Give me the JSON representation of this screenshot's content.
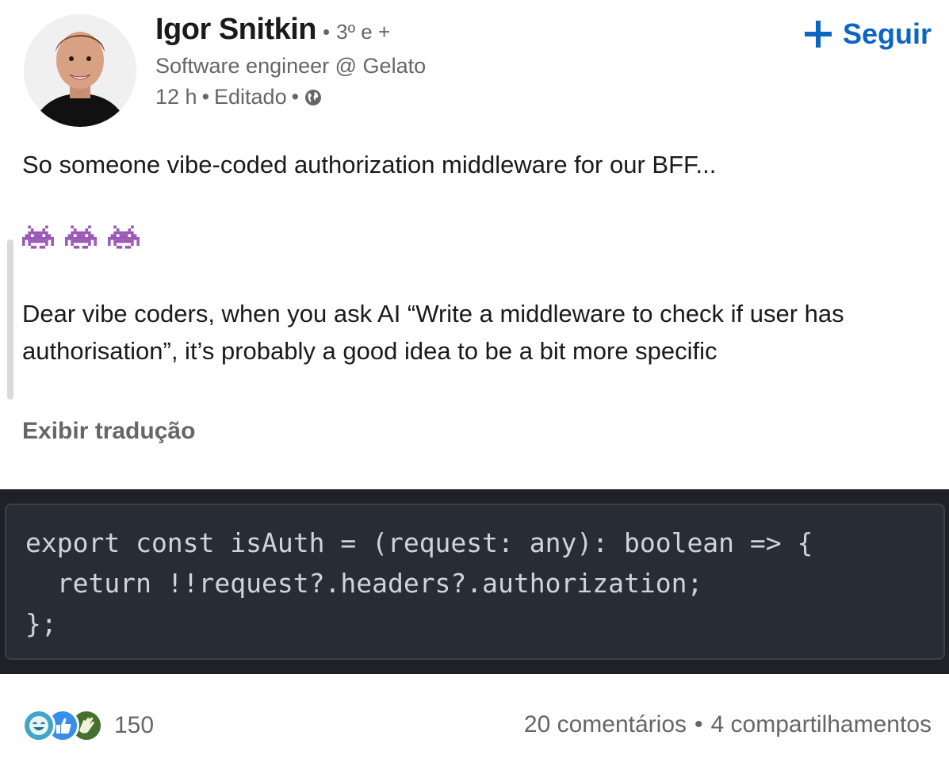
{
  "author": {
    "name": "Igor Snitkin",
    "degree": "3º e +",
    "headline": "Software engineer @ Gelato",
    "time": "12 h",
    "edited": "Editado",
    "separator": "•"
  },
  "follow": {
    "label": "Seguir"
  },
  "post": {
    "line1": "So someone vibe-coded authorization middleware for our BFF...",
    "emojis": [
      "👾",
      "👾",
      "👾"
    ],
    "paragraph": "Dear vibe coders, when you ask AI “Write a middleware to check if user has authorisation”, it’s probably a good idea to be a bit more specific",
    "translate_label": "Exibir tradução"
  },
  "code_image": {
    "lines": [
      "export const isAuth = (request: any): boolean => {",
      "  return !!request?.headers?.authorization;",
      "};"
    ]
  },
  "social": {
    "reaction_icons": [
      "funny-icon",
      "like-icon",
      "celebrate-icon"
    ],
    "reaction_count": "150",
    "comments": "20 comentários",
    "separator": "•",
    "shares": "4 compartilhamentos"
  },
  "colors": {
    "accent": "#0a66c2",
    "code_bg": "#282c34",
    "muted_text": "#666666"
  }
}
